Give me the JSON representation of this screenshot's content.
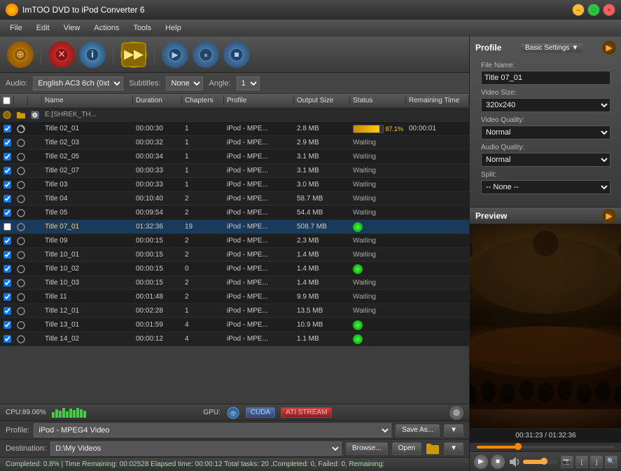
{
  "app": {
    "title": "ImTOO DVD to iPod Converter 6",
    "icon": "dvd-icon"
  },
  "titlebar": {
    "minimize": "–",
    "maximize": "□",
    "close": "×"
  },
  "menu": {
    "items": [
      "File",
      "Edit",
      "View",
      "Actions",
      "Tools",
      "Help"
    ]
  },
  "toolbar": {
    "buttons": [
      {
        "name": "add-button",
        "label": "➕",
        "title": "Add"
      },
      {
        "name": "remove-button",
        "label": "✕",
        "title": "Remove"
      },
      {
        "name": "info-button",
        "label": "ℹ",
        "title": "Info"
      },
      {
        "name": "convert-button",
        "label": "▶▶",
        "title": "Convert"
      },
      {
        "name": "play-button",
        "label": "▶",
        "title": "Play"
      },
      {
        "name": "pause-button",
        "label": "⏸",
        "title": "Pause"
      },
      {
        "name": "stop-button",
        "label": "■",
        "title": "Stop"
      }
    ]
  },
  "filters": {
    "audio_label": "Audio:",
    "audio_value": "English AC3 6ch (0xt",
    "subtitles_label": "Subtitles:",
    "subtitles_value": "None",
    "angle_label": "Angle:",
    "angle_value": "1"
  },
  "list": {
    "columns": [
      "",
      "",
      "",
      "Name",
      "Duration",
      "Chapters",
      "Profile",
      "Output Size",
      "Status",
      "Remaining Time"
    ],
    "rows": [
      {
        "id": "folder",
        "type": "folder",
        "name": "E:[SHREK_TH...",
        "duration": "",
        "chapters": "",
        "profile": "",
        "size": "",
        "status": "folder",
        "remaining": ""
      },
      {
        "id": "title_02_01",
        "type": "file",
        "checked": true,
        "name": "Title 02_01",
        "duration": "00:00:30",
        "chapters": "1",
        "profile": "iPod - MPE...",
        "size": "2.8 MB",
        "status": "progress",
        "progress": 87.1,
        "remaining": "00:00:01"
      },
      {
        "id": "title_02_03",
        "type": "file",
        "checked": true,
        "name": "Title 02_03",
        "duration": "00:00:32",
        "chapters": "1",
        "profile": "iPod - MPE...",
        "size": "2.9 MB",
        "status": "Waiting",
        "remaining": ""
      },
      {
        "id": "title_02_05",
        "type": "file",
        "checked": true,
        "name": "Title 02_05",
        "duration": "00:00:34",
        "chapters": "1",
        "profile": "iPod - MPE...",
        "size": "3.1 MB",
        "status": "Waiting",
        "remaining": ""
      },
      {
        "id": "title_02_07",
        "type": "file",
        "checked": true,
        "name": "Title 02_07",
        "duration": "00:00:33",
        "chapters": "1",
        "profile": "iPod - MPE...",
        "size": "3.1 MB",
        "status": "Waiting",
        "remaining": ""
      },
      {
        "id": "title_03",
        "type": "file",
        "checked": true,
        "name": "Title 03",
        "duration": "00:00:33",
        "chapters": "1",
        "profile": "iPod - MPE...",
        "size": "3.0 MB",
        "status": "Waiting",
        "remaining": ""
      },
      {
        "id": "title_04",
        "type": "file",
        "checked": true,
        "name": "Title 04",
        "duration": "00:10:40",
        "chapters": "2",
        "profile": "iPod - MPE...",
        "size": "58.7 MB",
        "status": "Waiting",
        "remaining": ""
      },
      {
        "id": "title_05",
        "type": "file",
        "checked": true,
        "name": "Title 05",
        "duration": "00:09:54",
        "chapters": "2",
        "profile": "iPod - MPE...",
        "size": "54.4 MB",
        "status": "Waiting",
        "remaining": ""
      },
      {
        "id": "title_07_01",
        "type": "file",
        "checked": false,
        "selected": true,
        "name": "Title 07_01",
        "duration": "01:32:36",
        "chapters": "19",
        "profile": "iPod - MPE...",
        "size": "508.7 MB",
        "status": "green",
        "remaining": ""
      },
      {
        "id": "title_09",
        "type": "file",
        "checked": true,
        "name": "Title 09",
        "duration": "00:00:15",
        "chapters": "2",
        "profile": "iPod - MPE...",
        "size": "2.3 MB",
        "status": "Waiting",
        "remaining": ""
      },
      {
        "id": "title_10_01",
        "type": "file",
        "checked": true,
        "name": "Title 10_01",
        "duration": "00:00:15",
        "chapters": "2",
        "profile": "iPod - MPE...",
        "size": "1.4 MB",
        "status": "Waiting",
        "remaining": ""
      },
      {
        "id": "title_10_02",
        "type": "file",
        "checked": true,
        "name": "Title 10_02",
        "duration": "00:00:15",
        "chapters": "0",
        "profile": "iPod - MPE...",
        "size": "1.4 MB",
        "status": "green",
        "remaining": ""
      },
      {
        "id": "title_10_03",
        "type": "file",
        "checked": true,
        "name": "Title 10_03",
        "duration": "00:00:15",
        "chapters": "2",
        "profile": "iPod - MPE...",
        "size": "1.4 MB",
        "status": "Waiting",
        "remaining": ""
      },
      {
        "id": "title_11",
        "type": "file",
        "checked": true,
        "name": "Title 11",
        "duration": "00:01:48",
        "chapters": "2",
        "profile": "iPod - MPE...",
        "size": "9.9 MB",
        "status": "Waiting",
        "remaining": ""
      },
      {
        "id": "title_12_01",
        "type": "file",
        "checked": true,
        "name": "Title 12_01",
        "duration": "00:02:28",
        "chapters": "1",
        "profile": "iPod - MPE...",
        "size": "13.5 MB",
        "status": "Waiting",
        "remaining": ""
      },
      {
        "id": "title_13_01",
        "type": "file",
        "checked": true,
        "name": "Title 13_01",
        "duration": "00:01:59",
        "chapters": "4",
        "profile": "iPod - MPE...",
        "size": "10.9 MB",
        "status": "green",
        "remaining": ""
      },
      {
        "id": "title_14_02",
        "type": "file",
        "checked": true,
        "name": "Title 14_02",
        "duration": "00:00:12",
        "chapters": "4",
        "profile": "iPod - MPE...",
        "size": "1.1 MB",
        "status": "green",
        "remaining": ""
      }
    ]
  },
  "cpu_status": {
    "label": "CPU:89.06%",
    "gpu_label": "GPU:",
    "cuda_label": "CUDA",
    "ati_label": "ATI STREAM"
  },
  "profile_bar": {
    "label": "Profile:",
    "value": "iPod - MPEG4 Video",
    "save_as": "Save As...",
    "dropdown": "▼"
  },
  "destination_bar": {
    "label": "Destination:",
    "value": "D:\\My Videos",
    "browse": "Browse...",
    "open": "Open"
  },
  "bottom_status": {
    "text": "Completed: 0.8%  |  Time Remaining: 00:02528  Elapsed time: 00:00:12  Total tasks: 20 ,Completed: 0, Failed: 0, Remaining:"
  },
  "right_panel": {
    "profile_section": {
      "title": "Profile",
      "basic_settings": "Basic Settings",
      "file_name_label": "File Name:",
      "file_name_value": "Title 07_01",
      "video_size_label": "Video Size:",
      "video_size_value": "320x240",
      "video_quality_label": "Video Quality:",
      "video_quality_value": "Normal",
      "audio_quality_label": "Audio Quality:",
      "audio_quality_value": "Normal",
      "split_label": "Split:"
    },
    "preview_section": {
      "title": "Preview",
      "time_current": "00:31:23",
      "time_total": "01:32:36"
    }
  }
}
